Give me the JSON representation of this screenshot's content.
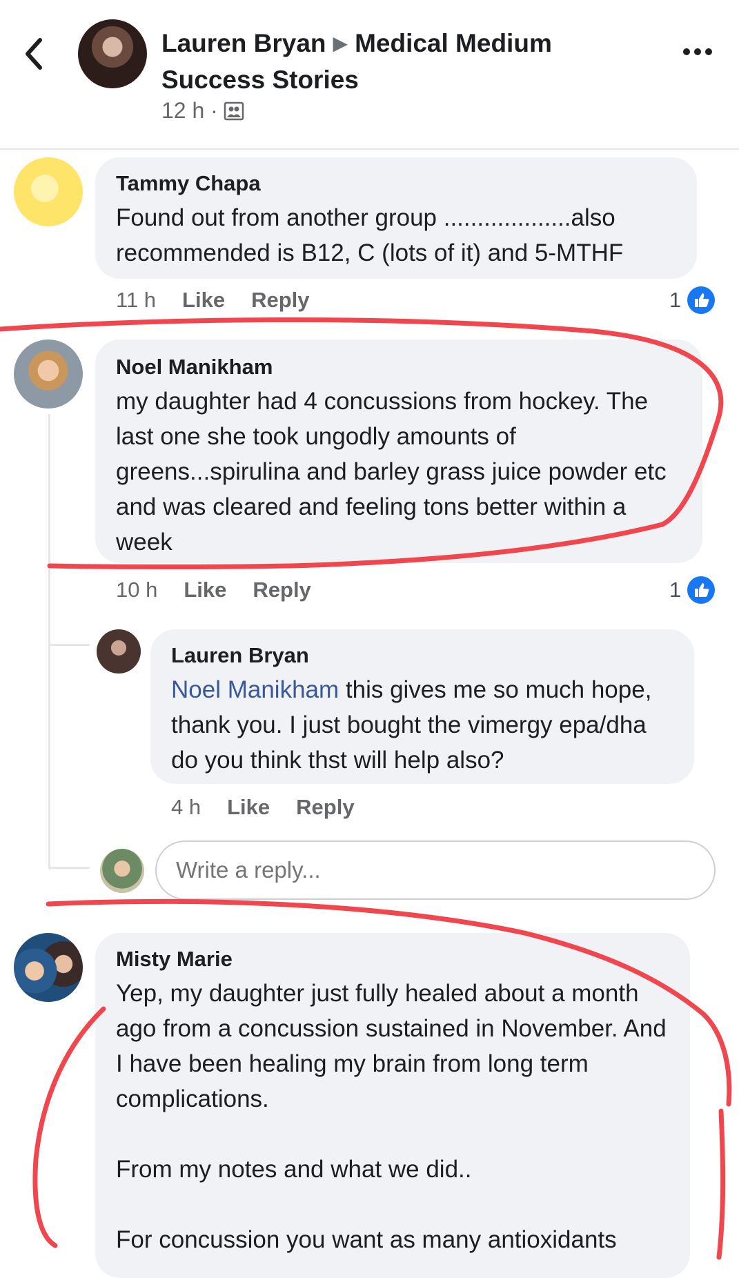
{
  "header": {
    "author": "Lauren Bryan",
    "group": "Medical Medium Success Stories",
    "time": "12 h ·"
  },
  "comments": [
    {
      "name": "Tammy Chapa",
      "text": "Found out from another group ...................also recommended is B12, C (lots of it) and 5-MTHF",
      "time": "11 h",
      "like": "Like",
      "reply": "Reply",
      "reactions": "1"
    },
    {
      "name": "Noel Manikham",
      "text": "my daughter had 4 concussions from hockey. The last one she took ungodly amounts of greens...spirulina and barley grass juice powder etc and was cleared and feeling tons better within a week",
      "time": "10 h",
      "like": "Like",
      "reply": "Reply",
      "reactions": "1"
    }
  ],
  "reply": {
    "name": "Lauren Bryan",
    "mention": "Noel Manikham",
    "text": " this gives me so much hope, thank you. I just bought the vimergy epa/dha do you think thst will help also?",
    "time": "4 h",
    "like": "Like",
    "reply": "Reply"
  },
  "reply_input": {
    "placeholder": "Write a reply..."
  },
  "comment3": {
    "name": "Misty Marie",
    "text": "Yep, my daughter just fully healed about a month ago from a concussion sustained in November. And I have been healing my brain from long term complications.\n\nFrom my notes and what we did..\n\nFor concussion you want as many antioxidants"
  },
  "colors": {
    "like_blue": "#1877f2",
    "highlight_red": "#f0474f",
    "bubble": "#f0f2f5"
  },
  "icons": [
    "chevron-left-icon",
    "more-dots-icon",
    "group-privacy-icon",
    "like-thumb-icon"
  ]
}
